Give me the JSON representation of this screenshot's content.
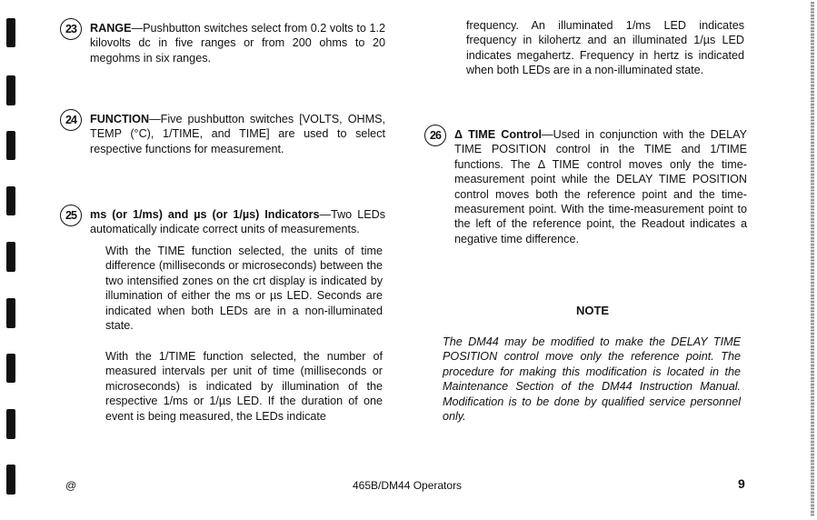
{
  "document": {
    "left_column": {
      "item_23": {
        "number": "23",
        "title": "RANGE",
        "text": "—Pushbutton switches select from 0.2 volts to 1.2 kilovolts dc in five ranges or from 200 ohms to 20 megohms in six ranges."
      },
      "item_24": {
        "number": "24",
        "title": "FUNCTION",
        "text": "—Five pushbutton switches [VOLTS, OHMS, TEMP (°C), 1/TIME, and TIME] are used to select respective functions for measurement."
      },
      "item_25": {
        "number": "25",
        "title": "ms (or 1/ms) and µs (or 1/µs) Indicators",
        "text": "—Two LEDs automatically indicate correct units of measurements."
      },
      "para_time": "With the TIME function selected, the units of time difference (milliseconds or microseconds) between the two intensified zones on the crt display is indicated by illumination of either the ms or µs LED. Seconds are indicated when both LEDs are in a non-illuminated state.",
      "para_1time": "With the 1/TIME function selected, the number of measured intervals per unit of time (milliseconds or microseconds) is indicated by illumination of the respective 1/ms or 1/µs LED. If the duration of one event is being measured, the LEDs indicate"
    },
    "right_column": {
      "para_continued": "frequency. An illuminated 1/ms LED indicates frequency in kilohertz and an illuminated 1/µs LED indicates megahertz. Frequency in hertz is indicated when both LEDs are in a non-illuminated state.",
      "item_26": {
        "number": "26",
        "title": "Δ TIME Control",
        "text": "—Used in conjunction with the DELAY TIME POSITION control in the TIME and 1/TIME functions. The Δ TIME control moves only the time-measurement point while the DELAY TIME POSITION control moves both the reference point and the time-measurement point. With the time-measurement point to the left of the reference point, the Readout indicates a negative time difference."
      },
      "note_heading": "NOTE",
      "note_text": "The DM44 may be modified to make the DELAY TIME POSITION control move only the reference point. The procedure for making this modification is located in the Maintenance Section of the DM44 Instruction Manual. Modification is to be done by qualified service personnel only."
    },
    "footer": {
      "symbol": "@",
      "title": "465B/DM44 Operators",
      "page_number": "9"
    }
  }
}
